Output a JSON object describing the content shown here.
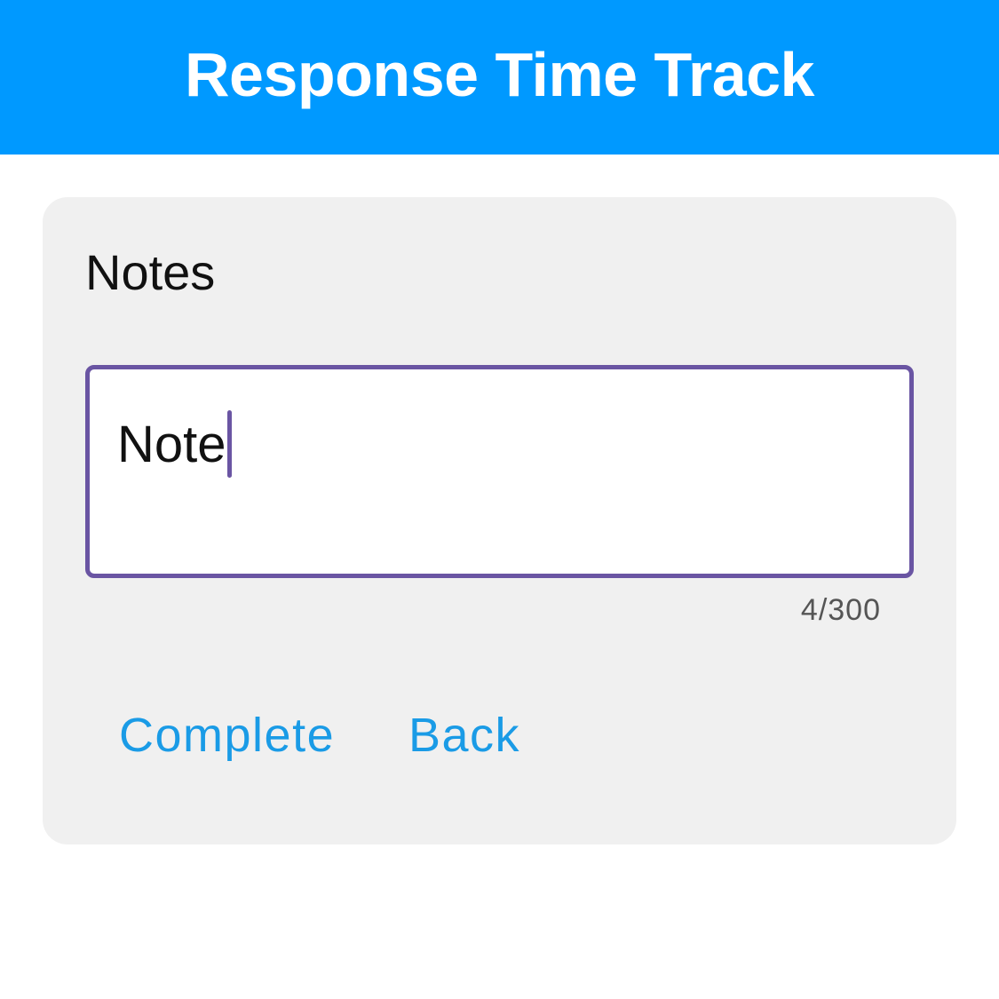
{
  "colors": {
    "app_bar": "#0099ff",
    "card_bg": "#f0f0f0",
    "field_border": "#6a55a3",
    "action_text": "#1a9be6"
  },
  "header": {
    "title": "Response Time Track"
  },
  "notes": {
    "label": "Notes",
    "value": "Note",
    "counter": "4/300"
  },
  "actions": {
    "complete_label": "Complete",
    "back_label": "Back"
  }
}
